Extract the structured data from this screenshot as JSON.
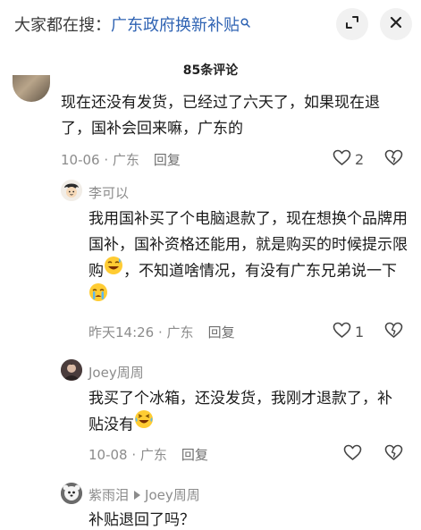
{
  "topbar": {
    "label": "大家都在搜：",
    "keyword": "广东政府换新补贴",
    "search_icon": "search-icon",
    "expand_icon": "expand-icon",
    "close_icon": "close-icon"
  },
  "header": {
    "count": "85条评论"
  },
  "comments": [
    {
      "text": "现在还没有发货，已经过了六天了，如果现在退了，国补会回来嘛，广东的",
      "date": "10-06",
      "location": "广东",
      "reply": "回复",
      "likes": "2"
    },
    {
      "author": "李可以",
      "text_part1": "我用国补买了个电脑退款了，现在想换个品牌用国补，国补资格还能用，就是购买的时候提示限购",
      "text_part2": "，不知道啥情况，有没有广东兄弟说一下",
      "date": "昨天14:26",
      "location": "广东",
      "reply": "回复",
      "likes": "1"
    },
    {
      "author": "Joey周周",
      "text": "我买了个冰箱，还没发货，我刚才退款了，补贴没有",
      "date": "10-08",
      "location": "广东",
      "reply": "回复",
      "likes": ""
    },
    {
      "author": "紫雨泪",
      "reply_to": "Joey周周",
      "text": "补贴退回了吗？"
    }
  ],
  "colors": {
    "keyword": "#2f63b3",
    "meta": "#8c8c8c"
  }
}
